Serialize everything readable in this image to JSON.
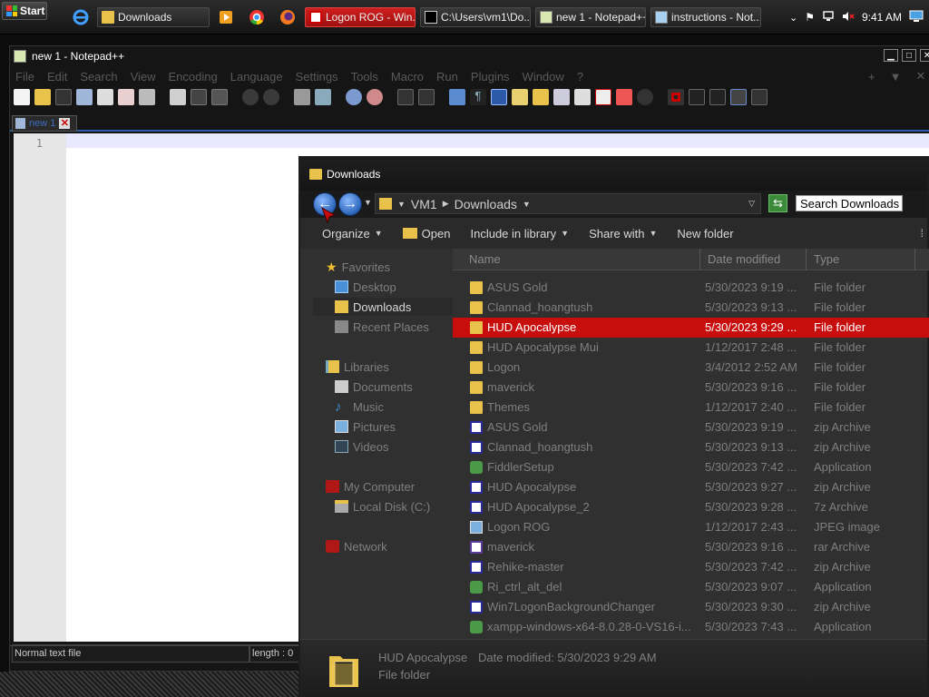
{
  "taskbar": {
    "start_label": "Start",
    "buttons": [
      {
        "label": "Downloads"
      },
      {
        "label": "Logon ROG - Win..."
      },
      {
        "label": "C:\\Users\\vm1\\Do..."
      },
      {
        "label": "new 1 - Notepad++"
      },
      {
        "label": "instructions - Not..."
      }
    ],
    "clock": "9:41 AM"
  },
  "notepad": {
    "title": "new 1 - Notepad++",
    "menu": [
      "File",
      "Edit",
      "Search",
      "View",
      "Encoding",
      "Language",
      "Settings",
      "Tools",
      "Macro",
      "Run",
      "Plugins",
      "Window",
      "?"
    ],
    "menu_right": [
      "+",
      "▼",
      "✕"
    ],
    "tab_label": "new 1",
    "line_number": "1",
    "status_left": "Normal text file",
    "status_length": "length : 0"
  },
  "explorer": {
    "title": "Downloads",
    "breadcrumb": [
      "VM1",
      "Downloads"
    ],
    "search_placeholder": "Search Downloads",
    "commands": [
      "Organize",
      "Open",
      "Include in library",
      "Share with",
      "New folder"
    ],
    "nav": {
      "favorites": "Favorites",
      "desktop": "Desktop",
      "downloads": "Downloads",
      "recent": "Recent Places",
      "libraries": "Libraries",
      "documents": "Documents",
      "music": "Music",
      "pictures": "Pictures",
      "videos": "Videos",
      "computer": "My Computer",
      "local_disk": "Local Disk (C:)",
      "network": "Network"
    },
    "columns": [
      "Name",
      "Date modified",
      "Type"
    ],
    "files": [
      {
        "name": "ASUS Gold",
        "date": "5/30/2023 9:19 ...",
        "type": "File folder",
        "icon": "folder-icon"
      },
      {
        "name": "Clannad_hoangtush",
        "date": "5/30/2023 9:13 ...",
        "type": "File folder",
        "icon": "folder-icon"
      },
      {
        "name": "HUD Apocalypse",
        "date": "5/30/2023 9:29 ...",
        "type": "File folder",
        "icon": "folder-icon"
      },
      {
        "name": "HUD Apocalypse Mui",
        "date": "1/12/2017 2:48 ...",
        "type": "File folder",
        "icon": "folder-icon"
      },
      {
        "name": "Logon",
        "date": "3/4/2012 2:52 AM",
        "type": "File folder",
        "icon": "folder-icon"
      },
      {
        "name": "maverick",
        "date": "5/30/2023 9:16 ...",
        "type": "File folder",
        "icon": "folder-icon"
      },
      {
        "name": "Themes",
        "date": "1/12/2017 2:40 ...",
        "type": "File folder",
        "icon": "folder-icon"
      },
      {
        "name": "ASUS Gold",
        "date": "5/30/2023 9:19 ...",
        "type": "zip Archive",
        "icon": "zip-icon"
      },
      {
        "name": "Clannad_hoangtush",
        "date": "5/30/2023 9:13 ...",
        "type": "zip Archive",
        "icon": "zip-icon"
      },
      {
        "name": "FiddlerSetup",
        "date": "5/30/2023 7:42 ...",
        "type": "Application",
        "icon": "app-icon"
      },
      {
        "name": "HUD Apocalypse",
        "date": "5/30/2023 9:27 ...",
        "type": "zip Archive",
        "icon": "zip-icon"
      },
      {
        "name": "HUD Apocalypse_2",
        "date": "5/30/2023 9:28 ...",
        "type": "7z Archive",
        "icon": "zip-icon"
      },
      {
        "name": "Logon ROG",
        "date": "1/12/2017 2:43 ...",
        "type": "JPEG image",
        "icon": "image-icon"
      },
      {
        "name": "maverick",
        "date": "5/30/2023 9:16 ...",
        "type": "rar Archive",
        "icon": "rar-icon"
      },
      {
        "name": "Rehike-master",
        "date": "5/30/2023 7:42 ...",
        "type": "zip Archive",
        "icon": "zip-icon"
      },
      {
        "name": "Ri_ctrl_alt_del",
        "date": "5/30/2023 9:07 ...",
        "type": "Application",
        "icon": "app-icon"
      },
      {
        "name": "Win7LogonBackgroundChanger",
        "date": "5/30/2023 9:30 ...",
        "type": "zip Archive",
        "icon": "zip-icon"
      },
      {
        "name": "xampp-windows-x64-8.0.28-0-VS16-i...",
        "date": "5/30/2023 7:43 ...",
        "type": "Application",
        "icon": "app-icon"
      }
    ],
    "selected_index": 2,
    "details": {
      "name": "HUD Apocalypse",
      "modified": "Date modified:  5/30/2023 9:29 AM",
      "type": "File folder"
    }
  },
  "colors": {
    "selection": "#c80d0d",
    "accent_blue": "#2a64b8"
  }
}
